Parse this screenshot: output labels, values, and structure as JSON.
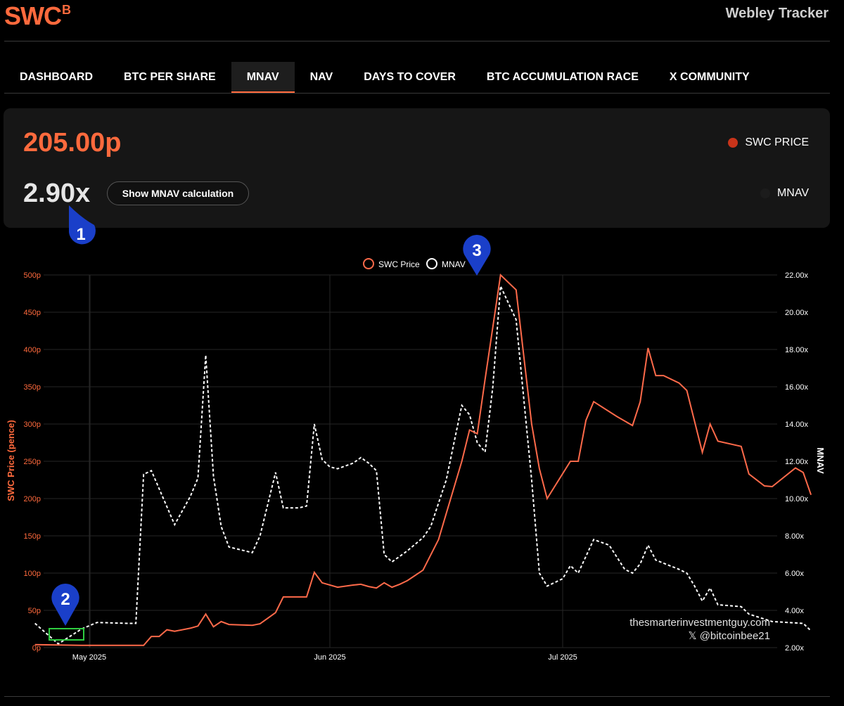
{
  "header": {
    "logo_text": "SWC",
    "logo_sup": "B",
    "site_title": "Webley Tracker"
  },
  "nav": {
    "items": [
      "DASHBOARD",
      "BTC PER SHARE",
      "MNAV",
      "NAV",
      "DAYS TO COVER",
      "BTC ACCUMULATION RACE",
      "X COMMUNITY"
    ],
    "active": "MNAV"
  },
  "summary": {
    "price": "205.00p",
    "mnav": "2.90x",
    "calc_button": "Show MNAV calculation",
    "legend_price": "SWC PRICE",
    "legend_mnav": "MNAV"
  },
  "annotations": {
    "marker1": "1",
    "marker2": "2",
    "marker3": "3"
  },
  "watermark": {
    "line1": "thesmarterinvestmentguy.com",
    "line2": "𝕏 @bitcoinbee21"
  },
  "colors": {
    "accent": "#ff6a3d",
    "price_line": "#ff6a4a",
    "mnav_line": "#ffffff",
    "marker": "#1a3fc9",
    "highlight_box": "#2ecc40"
  },
  "chart_data": {
    "type": "line",
    "legend": [
      "SWC Price",
      "MNAV"
    ],
    "ylabel": "SWC Price (pence)",
    "y2label": "MNAV",
    "ylim": [
      0,
      500
    ],
    "y2lim": [
      2,
      22
    ],
    "yticks": [
      "0p",
      "50p",
      "100p",
      "150p",
      "200p",
      "250p",
      "300p",
      "350p",
      "400p",
      "450p",
      "500p"
    ],
    "y2ticks": [
      "2.00x",
      "4.00x",
      "6.00x",
      "8.00x",
      "10.00x",
      "12.00x",
      "14.00x",
      "16.00x",
      "18.00x",
      "20.00x",
      "22.00x"
    ],
    "xlim": [
      "2025-04-24",
      "2025-07-25"
    ],
    "xticks": [
      {
        "date": "2025-05-01",
        "label": "May 2025"
      },
      {
        "date": "2025-06-01",
        "label": "Jun 2025"
      },
      {
        "date": "2025-07-01",
        "label": "Jul 2025"
      }
    ],
    "grid": true,
    "legend_position": "top-center",
    "series": [
      {
        "name": "SWC Price",
        "points": [
          [
            "2025-04-24",
            4
          ],
          [
            "2025-04-30",
            3
          ],
          [
            "2025-05-05",
            3
          ],
          [
            "2025-05-08",
            3
          ],
          [
            "2025-05-09",
            15
          ],
          [
            "2025-05-10",
            15
          ],
          [
            "2025-05-11",
            24
          ],
          [
            "2025-05-12",
            22
          ],
          [
            "2025-05-14",
            26
          ],
          [
            "2025-05-15",
            29
          ],
          [
            "2025-05-16",
            45
          ],
          [
            "2025-05-17",
            28
          ],
          [
            "2025-05-18",
            35
          ],
          [
            "2025-05-19",
            31
          ],
          [
            "2025-05-22",
            30
          ],
          [
            "2025-05-23",
            32
          ],
          [
            "2025-05-25",
            47
          ],
          [
            "2025-05-26",
            68
          ],
          [
            "2025-05-28",
            68
          ],
          [
            "2025-05-29",
            68
          ],
          [
            "2025-05-30",
            101
          ],
          [
            "2025-05-31",
            87
          ],
          [
            "2025-06-02",
            81
          ],
          [
            "2025-06-04",
            84
          ],
          [
            "2025-06-05",
            85
          ],
          [
            "2025-06-06",
            82
          ],
          [
            "2025-06-07",
            80
          ],
          [
            "2025-06-08",
            87
          ],
          [
            "2025-06-09",
            81
          ],
          [
            "2025-06-10",
            85
          ],
          [
            "2025-06-11",
            90
          ],
          [
            "2025-06-13",
            104
          ],
          [
            "2025-06-15",
            145
          ],
          [
            "2025-06-16",
            180
          ],
          [
            "2025-06-18",
            250
          ],
          [
            "2025-06-19",
            292
          ],
          [
            "2025-06-20",
            287
          ],
          [
            "2025-06-21",
            360
          ],
          [
            "2025-06-23",
            500
          ],
          [
            "2025-06-25",
            480
          ],
          [
            "2025-06-27",
            300
          ],
          [
            "2025-06-28",
            240
          ],
          [
            "2025-06-29",
            200
          ],
          [
            "2025-07-02",
            250
          ],
          [
            "2025-07-03",
            250
          ],
          [
            "2025-07-04",
            305
          ],
          [
            "2025-07-05",
            330
          ],
          [
            "2025-07-08",
            310
          ],
          [
            "2025-07-10",
            298
          ],
          [
            "2025-07-11",
            330
          ],
          [
            "2025-07-12",
            402
          ],
          [
            "2025-07-13",
            365
          ],
          [
            "2025-07-14",
            365
          ],
          [
            "2025-07-16",
            355
          ],
          [
            "2025-07-17",
            345
          ],
          [
            "2025-07-19",
            262
          ],
          [
            "2025-07-20",
            300
          ],
          [
            "2025-07-21",
            277
          ],
          [
            "2025-07-24",
            270
          ],
          [
            "2025-07-25",
            233
          ],
          [
            "2025-07-27",
            217
          ],
          [
            "2025-07-28",
            216
          ],
          [
            "2025-07-31",
            241
          ],
          [
            "2025-08-01",
            235
          ],
          [
            "2025-08-02",
            205
          ]
        ]
      },
      {
        "name": "MNAV",
        "points": [
          [
            "2025-04-24",
            3.3
          ],
          [
            "2025-04-27",
            2.2
          ],
          [
            "2025-04-30",
            3.0
          ],
          [
            "2025-05-02",
            3.35
          ],
          [
            "2025-05-06",
            3.3
          ],
          [
            "2025-05-07",
            3.3
          ],
          [
            "2025-05-08",
            11.3
          ],
          [
            "2025-05-09",
            11.5
          ],
          [
            "2025-05-12",
            8.6
          ],
          [
            "2025-05-14",
            10.1
          ],
          [
            "2025-05-15",
            11.1
          ],
          [
            "2025-05-16",
            17.7
          ],
          [
            "2025-05-17",
            11.2
          ],
          [
            "2025-05-18",
            8.5
          ],
          [
            "2025-05-19",
            7.4
          ],
          [
            "2025-05-21",
            7.2
          ],
          [
            "2025-05-22",
            7.1
          ],
          [
            "2025-05-23",
            8.0
          ],
          [
            "2025-05-25",
            11.4
          ],
          [
            "2025-05-26",
            9.5
          ],
          [
            "2025-05-28",
            9.5
          ],
          [
            "2025-05-29",
            9.6
          ],
          [
            "2025-05-30",
            14.0
          ],
          [
            "2025-05-31",
            12.1
          ],
          [
            "2025-06-01",
            11.7
          ],
          [
            "2025-06-02",
            11.6
          ],
          [
            "2025-06-04",
            11.9
          ],
          [
            "2025-06-05",
            12.2
          ],
          [
            "2025-06-06",
            11.9
          ],
          [
            "2025-06-07",
            11.5
          ],
          [
            "2025-06-08",
            7.0
          ],
          [
            "2025-06-09",
            6.6
          ],
          [
            "2025-06-11",
            7.2
          ],
          [
            "2025-06-13",
            7.9
          ],
          [
            "2025-06-14",
            8.5
          ],
          [
            "2025-06-16",
            11.0
          ],
          [
            "2025-06-17",
            13.0
          ],
          [
            "2025-06-18",
            15.0
          ],
          [
            "2025-06-19",
            14.5
          ],
          [
            "2025-06-20",
            13.0
          ],
          [
            "2025-06-21",
            12.5
          ],
          [
            "2025-06-22",
            16.0
          ],
          [
            "2025-06-23",
            21.4
          ],
          [
            "2025-06-25",
            19.6
          ],
          [
            "2025-06-27",
            11.0
          ],
          [
            "2025-06-28",
            6.0
          ],
          [
            "2025-06-29",
            5.3
          ],
          [
            "2025-07-01",
            5.7
          ],
          [
            "2025-07-02",
            6.4
          ],
          [
            "2025-07-03",
            6.0
          ],
          [
            "2025-07-05",
            7.8
          ],
          [
            "2025-07-07",
            7.5
          ],
          [
            "2025-07-09",
            6.2
          ],
          [
            "2025-07-10",
            6.0
          ],
          [
            "2025-07-11",
            6.5
          ],
          [
            "2025-07-12",
            7.5
          ],
          [
            "2025-07-13",
            6.7
          ],
          [
            "2025-07-16",
            6.2
          ],
          [
            "2025-07-17",
            6.0
          ],
          [
            "2025-07-18",
            5.3
          ],
          [
            "2025-07-19",
            4.5
          ],
          [
            "2025-07-20",
            5.2
          ],
          [
            "2025-07-21",
            4.3
          ],
          [
            "2025-07-24",
            4.2
          ],
          [
            "2025-07-25",
            3.8
          ],
          [
            "2025-07-28",
            3.4
          ],
          [
            "2025-08-01",
            3.3
          ],
          [
            "2025-08-02",
            2.9
          ]
        ]
      }
    ]
  }
}
